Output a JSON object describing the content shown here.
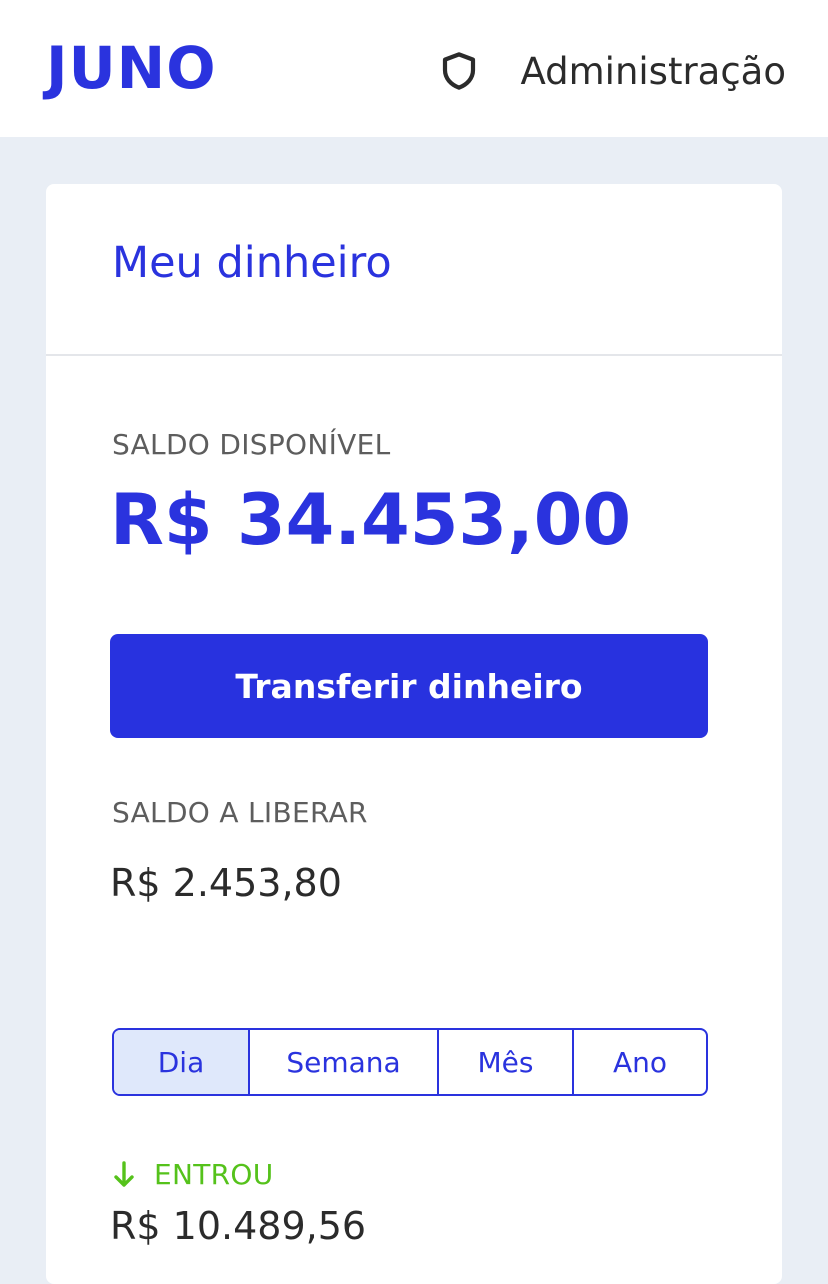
{
  "header": {
    "logo_text": "JUNO",
    "admin_label": "Administração",
    "admin_icon": "shield-icon"
  },
  "card": {
    "title": "Meu dinheiro",
    "available_label": "SALDO DISPONÍVEL",
    "available_value": "R$ 34.453,00",
    "transfer_button": "Transferir dinheiro",
    "pending_label": "SALDO A LIBERAR",
    "pending_value": "R$ 2.453,80",
    "period_tabs": [
      "Dia",
      "Semana",
      "Mês",
      "Ano"
    ],
    "selected_tab": "Dia",
    "in_label": "ENTROU",
    "in_icon": "arrow-down-icon",
    "in_value": "R$ 10.489,56"
  },
  "colors": {
    "brand": "#2a33de",
    "button": "#2832df",
    "page_bg": "#e9eef5",
    "income": "#55c21b",
    "tab_active_bg": "#dfe8fb"
  }
}
